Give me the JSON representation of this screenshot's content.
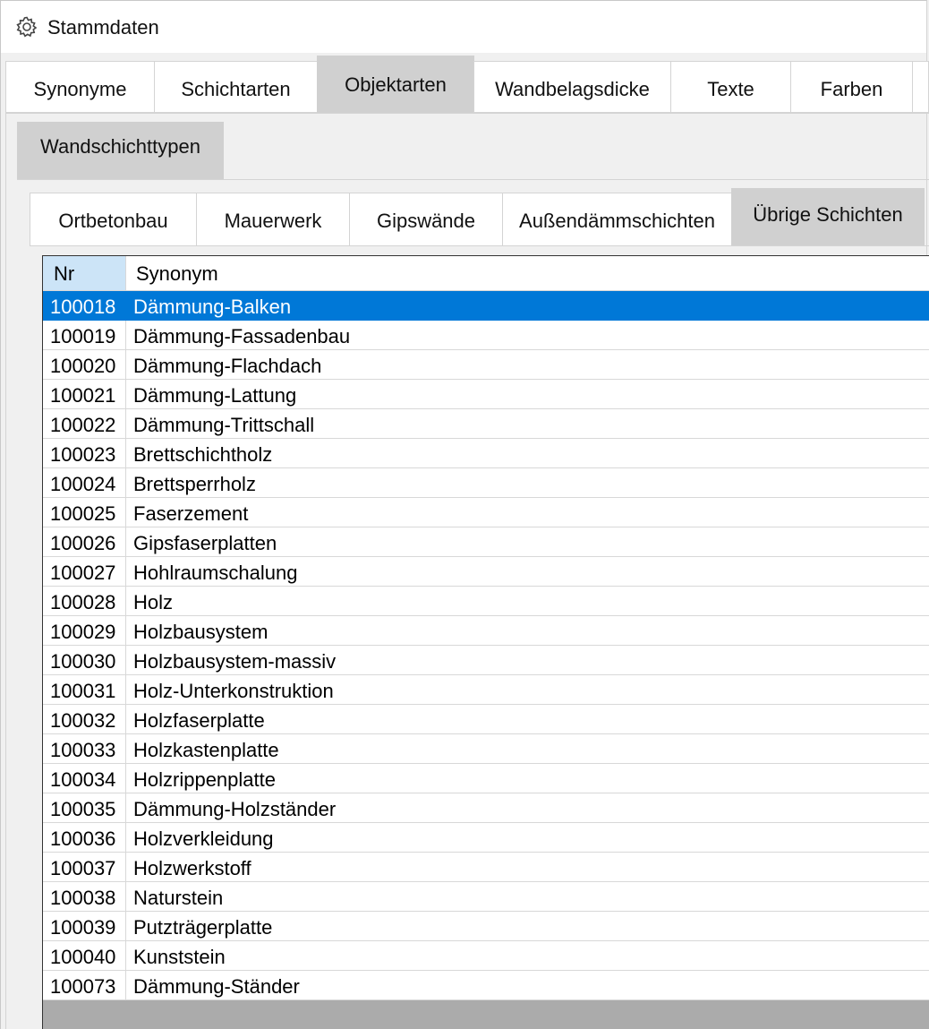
{
  "window": {
    "title": "Stammdaten",
    "icon": "gear-icon"
  },
  "tabs_level1": [
    {
      "label": "Synonyme",
      "active": false
    },
    {
      "label": "Schichtarten",
      "active": false
    },
    {
      "label": "Objektarten",
      "active": true
    },
    {
      "label": "Wandbelagsdicke",
      "active": false
    },
    {
      "label": "Texte",
      "active": false
    },
    {
      "label": "Farben",
      "active": false
    }
  ],
  "tabs_level2": [
    {
      "label": "Wandschichttypen",
      "active": true
    }
  ],
  "tabs_level3": [
    {
      "label": "Ortbetonbau",
      "active": false
    },
    {
      "label": "Mauerwerk",
      "active": false
    },
    {
      "label": "Gipswände",
      "active": false
    },
    {
      "label": "Außendämmschichten",
      "active": false
    },
    {
      "label": "Übrige Schichten",
      "active": true
    }
  ],
  "grid": {
    "columns": [
      "Nr",
      "Synonym"
    ],
    "selected_index": 0,
    "rows": [
      {
        "nr": "100018",
        "synonym": "Dämmung-Balken"
      },
      {
        "nr": "100019",
        "synonym": "Dämmung-Fassadenbau"
      },
      {
        "nr": "100020",
        "synonym": "Dämmung-Flachdach"
      },
      {
        "nr": "100021",
        "synonym": "Dämmung-Lattung"
      },
      {
        "nr": "100022",
        "synonym": "Dämmung-Trittschall"
      },
      {
        "nr": "100023",
        "synonym": "Brettschichtholz"
      },
      {
        "nr": "100024",
        "synonym": "Brettsperrholz"
      },
      {
        "nr": "100025",
        "synonym": "Faserzement"
      },
      {
        "nr": "100026",
        "synonym": "Gipsfaserplatten"
      },
      {
        "nr": "100027",
        "synonym": "Hohlraumschalung"
      },
      {
        "nr": "100028",
        "synonym": "Holz"
      },
      {
        "nr": "100029",
        "synonym": "Holzbausystem"
      },
      {
        "nr": "100030",
        "synonym": "Holzbausystem-massiv"
      },
      {
        "nr": "100031",
        "synonym": "Holz-Unterkonstruktion"
      },
      {
        "nr": "100032",
        "synonym": "Holzfaserplatte"
      },
      {
        "nr": "100033",
        "synonym": "Holzkastenplatte"
      },
      {
        "nr": "100034",
        "synonym": "Holzrippenplatte"
      },
      {
        "nr": "100035",
        "synonym": "Dämmung-Holzständer"
      },
      {
        "nr": "100036",
        "synonym": "Holzverkleidung"
      },
      {
        "nr": "100037",
        "synonym": "Holzwerkstoff"
      },
      {
        "nr": "100038",
        "synonym": "Naturstein"
      },
      {
        "nr": "100039",
        "synonym": "Putzträgerplatte"
      },
      {
        "nr": "100040",
        "synonym": "Kunststein"
      },
      {
        "nr": "100073",
        "synonym": "Dämmung-Ständer"
      }
    ]
  },
  "colors": {
    "selection": "#0078d7",
    "active_tab": "#d0d0d0",
    "header_nr": "#cce4f7"
  }
}
